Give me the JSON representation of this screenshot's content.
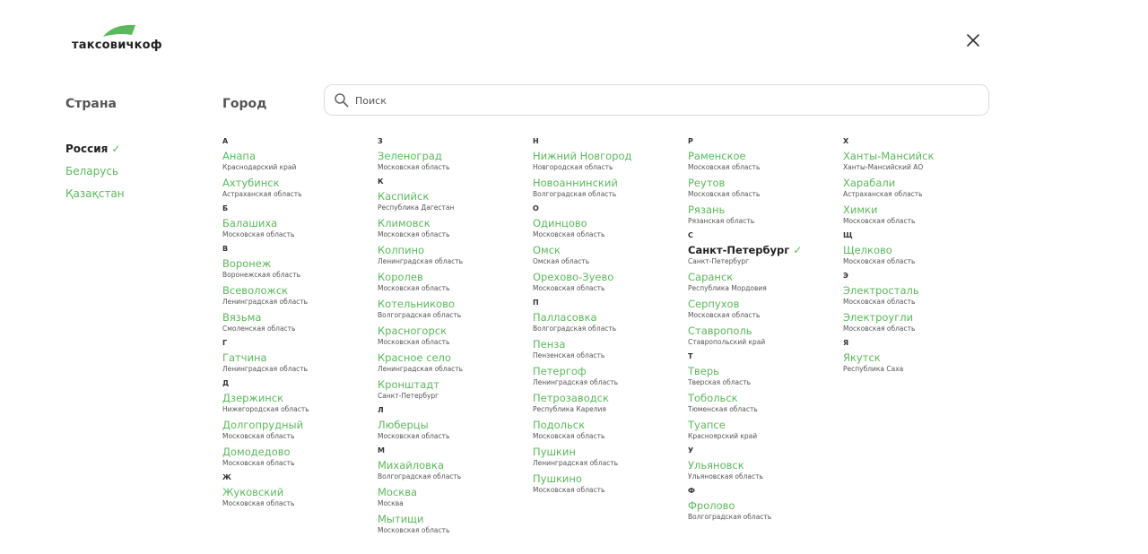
{
  "brand": {
    "name": "таксовичкоф",
    "accent": "#5cb85c"
  },
  "headings": {
    "country": "Страна",
    "city": "Город"
  },
  "search": {
    "placeholder": "Поиск",
    "value": ""
  },
  "countries": [
    {
      "name": "Россия",
      "selected": true
    },
    {
      "name": "Беларусь",
      "selected": false
    },
    {
      "name": "Қазақстан",
      "selected": false
    }
  ],
  "columns": [
    [
      {
        "letter": "А",
        "cities": [
          {
            "name": "Анапа",
            "region": "Краснодарский край"
          },
          {
            "name": "Ахтубинск",
            "region": "Астраханская область"
          }
        ]
      },
      {
        "letter": "Б",
        "cities": [
          {
            "name": "Балашиха",
            "region": "Московская область"
          }
        ]
      },
      {
        "letter": "В",
        "cities": [
          {
            "name": "Воронеж",
            "region": "Воронежская область"
          },
          {
            "name": "Всеволожск",
            "region": "Ленинградская область"
          },
          {
            "name": "Вязьма",
            "region": "Смоленская область"
          }
        ]
      },
      {
        "letter": "Г",
        "cities": [
          {
            "name": "Гатчина",
            "region": "Ленинградская область"
          }
        ]
      },
      {
        "letter": "Д",
        "cities": [
          {
            "name": "Дзержинск",
            "region": "Нижегородская область"
          },
          {
            "name": "Долгопрудный",
            "region": "Московская область"
          },
          {
            "name": "Домодедово",
            "region": "Московская область"
          }
        ]
      },
      {
        "letter": "Ж",
        "cities": [
          {
            "name": "Жуковский",
            "region": "Московская область"
          }
        ]
      }
    ],
    [
      {
        "letter": "З",
        "cities": [
          {
            "name": "Зеленоград",
            "region": "Московская область"
          }
        ]
      },
      {
        "letter": "К",
        "cities": [
          {
            "name": "Каспийск",
            "region": "Республика Дагестан"
          },
          {
            "name": "Климовск",
            "region": "Московская область"
          },
          {
            "name": "Колпино",
            "region": "Ленинградская область"
          },
          {
            "name": "Королев",
            "region": "Московская область"
          },
          {
            "name": "Котельниково",
            "region": "Волгоградская область"
          },
          {
            "name": "Красногорск",
            "region": "Московская область"
          },
          {
            "name": "Красное село",
            "region": "Ленинградская область"
          },
          {
            "name": "Кронштадт",
            "region": "Санкт-Петербург"
          }
        ]
      },
      {
        "letter": "Л",
        "cities": [
          {
            "name": "Люберцы",
            "region": "Московская область"
          }
        ]
      },
      {
        "letter": "М",
        "cities": [
          {
            "name": "Михайловка",
            "region": "Волгоградская область"
          },
          {
            "name": "Москва",
            "region": "Москва"
          },
          {
            "name": "Мытищи",
            "region": "Московская область"
          }
        ]
      }
    ],
    [
      {
        "letter": "Н",
        "cities": [
          {
            "name": "Нижний Новгород",
            "region": "Новгородская область"
          },
          {
            "name": "Новоаннинский",
            "region": "Волгоградская область"
          }
        ]
      },
      {
        "letter": "О",
        "cities": [
          {
            "name": "Одинцово",
            "region": "Московская область"
          },
          {
            "name": "Омск",
            "region": "Омская область"
          },
          {
            "name": "Орехово-Зуево",
            "region": "Московская область"
          }
        ]
      },
      {
        "letter": "П",
        "cities": [
          {
            "name": "Палласовка",
            "region": "Волгоградская область"
          },
          {
            "name": "Пенза",
            "region": "Пензенская область"
          },
          {
            "name": "Петергоф",
            "region": "Ленинградская область"
          },
          {
            "name": "Петрозаводск",
            "region": "Республика Карелия"
          },
          {
            "name": "Подольск",
            "region": "Московская область"
          },
          {
            "name": "Пушкин",
            "region": "Ленинградская область"
          },
          {
            "name": "Пушкино",
            "region": "Московская область"
          }
        ]
      }
    ],
    [
      {
        "letter": "Р",
        "cities": [
          {
            "name": "Раменское",
            "region": "Московская область"
          },
          {
            "name": "Реутов",
            "region": "Московская область"
          },
          {
            "name": "Рязань",
            "region": "Рязанская область"
          }
        ]
      },
      {
        "letter": "С",
        "cities": [
          {
            "name": "Санкт-Петербург",
            "region": "Санкт-Петербург",
            "selected": true
          },
          {
            "name": "Саранск",
            "region": "Республика Мордовия"
          },
          {
            "name": "Серпухов",
            "region": "Московская область"
          },
          {
            "name": "Ставрополь",
            "region": "Ставропольский край"
          }
        ]
      },
      {
        "letter": "Т",
        "cities": [
          {
            "name": "Тверь",
            "region": "Тверская область"
          },
          {
            "name": "Тобольск",
            "region": "Тюменская область"
          },
          {
            "name": "Туапсе",
            "region": "Красноярский край"
          }
        ]
      },
      {
        "letter": "У",
        "cities": [
          {
            "name": "Ульяновск",
            "region": "Ульяновская область"
          }
        ]
      },
      {
        "letter": "Ф",
        "cities": [
          {
            "name": "Фролово",
            "region": "Волгоградская область"
          }
        ]
      }
    ],
    [
      {
        "letter": "Х",
        "cities": [
          {
            "name": "Ханты-Мансийск",
            "region": "Ханты-Мансийский АО"
          },
          {
            "name": "Харабали",
            "region": "Астраханская область"
          },
          {
            "name": "Химки",
            "region": "Московская область"
          }
        ]
      },
      {
        "letter": "Щ",
        "cities": [
          {
            "name": "Щелково",
            "region": "Московская область"
          }
        ]
      },
      {
        "letter": "Э",
        "cities": [
          {
            "name": "Электросталь",
            "region": "Московская область"
          },
          {
            "name": "Электроугли",
            "region": "Московская область"
          }
        ]
      },
      {
        "letter": "Я",
        "cities": [
          {
            "name": "Якутск",
            "region": "Республика Саха"
          }
        ]
      }
    ]
  ]
}
